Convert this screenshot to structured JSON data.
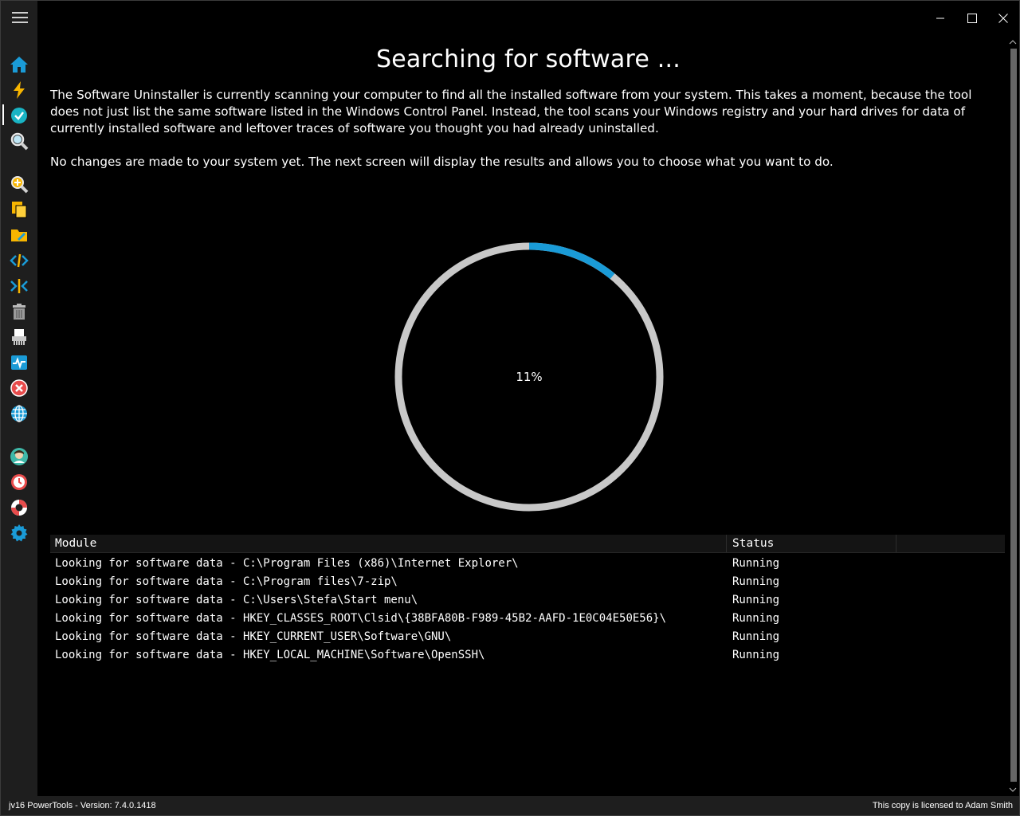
{
  "window": {
    "controls": [
      "minimize",
      "maximize",
      "close"
    ]
  },
  "sidebar": {
    "icons": [
      "home-icon",
      "lightning-icon",
      "check-circle-icon",
      "search-icon",
      "zoom-plus-icon",
      "copy-files-icon",
      "folder-edit-icon",
      "code-expand-icon",
      "code-collapse-icon",
      "trash-icon",
      "shredder-icon",
      "monitor-icon",
      "error-circle-icon",
      "globe-icon",
      "user-icon",
      "clock-icon",
      "lifebuoy-icon",
      "gear-icon"
    ]
  },
  "main": {
    "title": "Searching for software ...",
    "intro": "The Software Uninstaller is currently scanning your computer to find all the installed software from your system. This takes a moment, because the tool does not just list the same software listed in the Windows Control Panel. Instead, the tool scans your Windows registry and your hard drives for data of currently installed software and leftover traces of software you thought you had already uninstalled.",
    "note": "No changes are made to your system yet. The next screen will display the results and allows you to choose what you want to do.",
    "progress": {
      "value": 0.11,
      "label": "11%",
      "track_color": "#c8c8c8",
      "fill_color": "#1a9bd7"
    }
  },
  "table": {
    "headers": [
      "Module",
      "Status"
    ],
    "rows": [
      {
        "module": "Looking for software data - C:\\Program Files (x86)\\Internet Explorer\\",
        "status": "Running"
      },
      {
        "module": "Looking for software data - C:\\Program files\\7-zip\\",
        "status": "Running"
      },
      {
        "module": "Looking for software data - C:\\Users\\Stefa\\Start menu\\",
        "status": "Running"
      },
      {
        "module": "Looking for software data - HKEY_CLASSES_ROOT\\Clsid\\{38BFA80B-F989-45B2-AAFD-1E0C04E50E56}\\",
        "status": "Running"
      },
      {
        "module": "Looking for software data - HKEY_CURRENT_USER\\Software\\GNU\\",
        "status": "Running"
      },
      {
        "module": "Looking for software data - HKEY_LOCAL_MACHINE\\Software\\OpenSSH\\",
        "status": "Running"
      }
    ]
  },
  "statusbar": {
    "left": "jv16 PowerTools - Version: 7.4.0.1418",
    "right": "This copy is licensed to Adam Smith"
  }
}
